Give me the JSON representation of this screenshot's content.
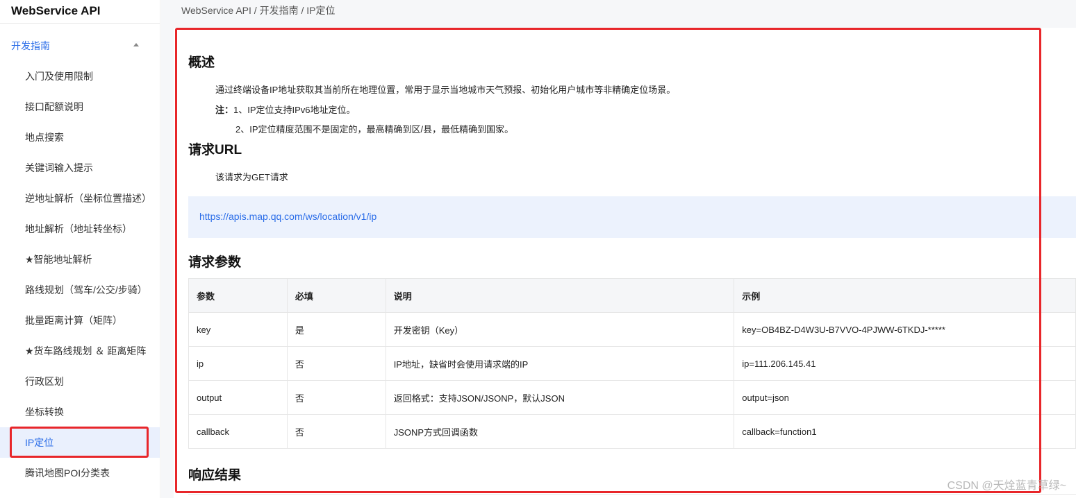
{
  "sidebar": {
    "app_title": "WebService API",
    "group_label": "开发指南",
    "items": [
      {
        "label": "入门及使用限制"
      },
      {
        "label": "接口配额说明"
      },
      {
        "label": "地点搜索"
      },
      {
        "label": "关键词输入提示"
      },
      {
        "label": "逆地址解析（坐标位置描述）"
      },
      {
        "label": "地址解析（地址转坐标）"
      },
      {
        "label": "★智能地址解析"
      },
      {
        "label": "路线规划（驾车/公交/步骑）"
      },
      {
        "label": "批量距离计算（矩阵）"
      },
      {
        "label": "★货车路线规划 ＆ 距离矩阵"
      },
      {
        "label": "行政区划"
      },
      {
        "label": "坐标转换"
      },
      {
        "label": "IP定位",
        "active": true
      },
      {
        "label": "腾讯地图POI分类表"
      }
    ]
  },
  "breadcrumb": "WebService API / 开发指南 / IP定位",
  "sections": {
    "overview_title": "概述",
    "overview_text": "通过终端设备IP地址获取其当前所在地理位置，常用于显示当地城市天气预报、初始化用户城市等非精确定位场景。",
    "note_label": "注：",
    "note_1": "1、IP定位支持IPv6地址定位。",
    "note_2": "2、IP定位精度范围不是固定的，最高精确到区/县，最低精确到国家。",
    "url_title": "请求URL",
    "url_text": "该请求为GET请求",
    "url": "https://apis.map.qq.com/ws/location/v1/ip",
    "params_title": "请求参数",
    "response_title": "响应结果"
  },
  "params_table": {
    "headers": [
      "参数",
      "必填",
      "说明",
      "示例"
    ],
    "rows": [
      [
        "key",
        "是",
        "开发密钥（Key）",
        "key=OB4BZ-D4W3U-B7VVO-4PJWW-6TKDJ-*****"
      ],
      [
        "ip",
        "否",
        "IP地址，缺省时会使用请求端的IP",
        "ip=111.206.145.41"
      ],
      [
        "output",
        "否",
        "返回格式：支持JSON/JSONP，默认JSON",
        "output=json"
      ],
      [
        "callback",
        "否",
        "JSONP方式回调函数",
        "callback=function1"
      ]
    ]
  },
  "watermark": "CSDN @天烇蓝青草绿~",
  "colors": {
    "accent": "#2b6de8",
    "highlight_border": "#e8262a",
    "url_box_bg": "#ecf2fd"
  }
}
